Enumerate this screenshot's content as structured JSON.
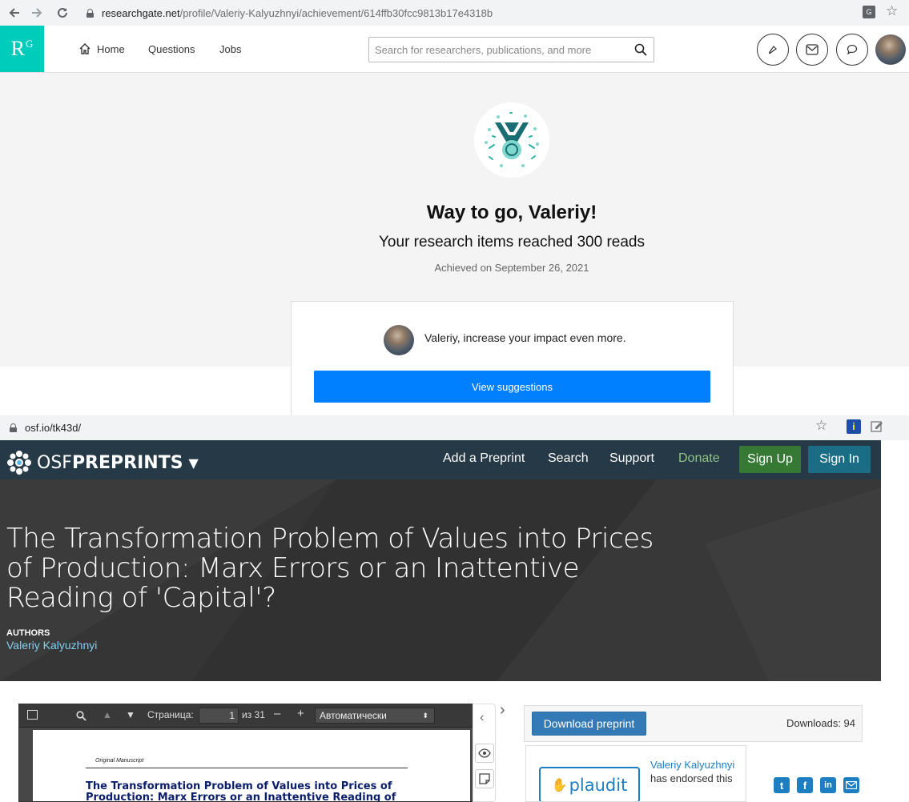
{
  "browser1": {
    "url_host": "researchgate.net",
    "url_path": "/profile/Valeriy-Kalyuzhnyi/achievement/614ffb30fcc9813b17e4318b"
  },
  "rg": {
    "logo_main": "R",
    "logo_sup": "G",
    "nav": {
      "home": "Home",
      "questions": "Questions",
      "jobs": "Jobs"
    },
    "search_placeholder": "Search for researchers, publications, and more",
    "title": "Way to go, Valeriy!",
    "subtitle": "Your research items reached 300 reads",
    "date": "Achieved on September 26, 2021",
    "card_text": "Valeriy, increase your impact even more.",
    "card_button": "View suggestions",
    "colors": {
      "brand": "#00ccbb",
      "button": "#0080ff"
    }
  },
  "browser2": {
    "url": "osf.io/tk43d/"
  },
  "osf": {
    "brand_light": "OSF",
    "brand_bold": "PREPRINTS",
    "nav": {
      "add": "Add a Preprint",
      "search": "Search",
      "support": "Support",
      "donate": "Donate",
      "signup": "Sign Up",
      "signin": "Sign In"
    },
    "title": "The Transformation Problem of Values into Prices of Production: Marx Errors or an Inattentive Reading of 'Capital'?",
    "authors_label": "AUTHORS",
    "author": "Valeriy Kalyuzhnyi",
    "pdf": {
      "page_label": "Страница:",
      "page_value": "1",
      "page_total": "из 31",
      "zoom": "Автоматически",
      "orig_label": "Original Manuscript",
      "heading": "The Transformation Problem of Values into Prices of Production: Marx Errors or an Inattentive Reading of ‘Capital’?"
    },
    "download_button": "Download preprint",
    "downloads": "Downloads: 94",
    "plaudit": {
      "logo": "plaudit",
      "endorser": "Valeriy Kalyuzhnyi",
      "text_after": " has endorsed this"
    },
    "colors": {
      "nav_bg": "#263947",
      "signup": "#357935",
      "signin": "#1b6d85",
      "donate": "#90c488"
    }
  }
}
